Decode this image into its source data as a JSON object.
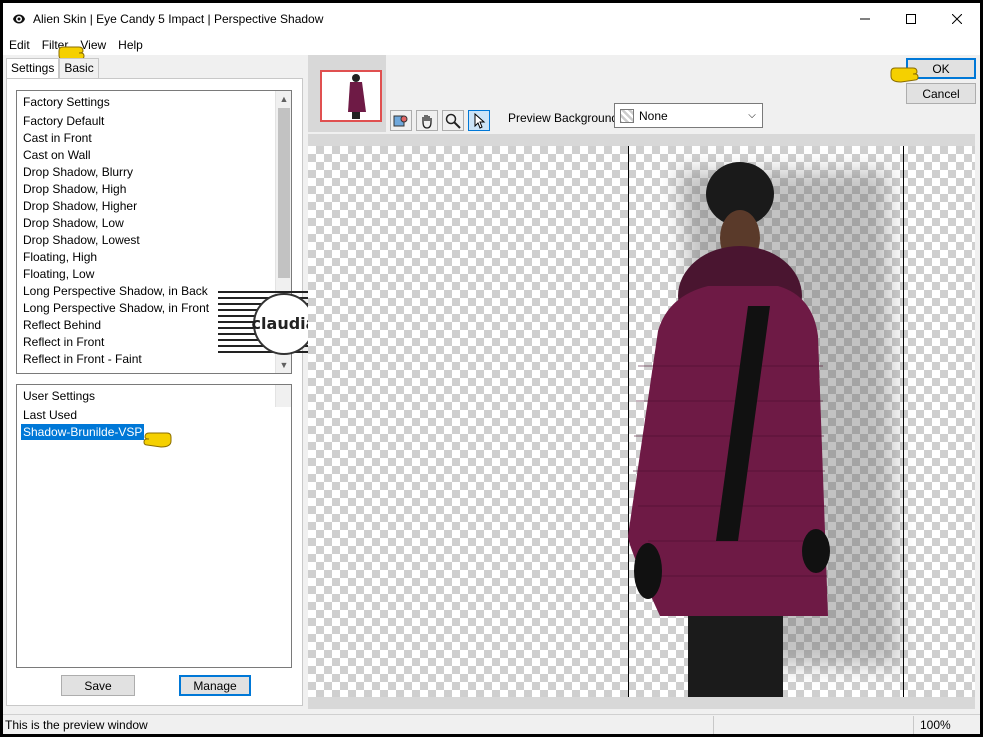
{
  "window": {
    "title": "Alien Skin | Eye Candy 5 Impact | Perspective Shadow"
  },
  "menu": [
    "Edit",
    "Filter",
    "View",
    "Help"
  ],
  "tabs": {
    "settings": "Settings",
    "basic": "Basic"
  },
  "factory": {
    "header": "Factory Settings",
    "items": [
      "Factory Default",
      "Cast in Front",
      "Cast on Wall",
      "Drop Shadow, Blurry",
      "Drop Shadow, High",
      "Drop Shadow, Higher",
      "Drop Shadow, Low",
      "Drop Shadow, Lowest",
      "Floating, High",
      "Floating, Low",
      "Long Perspective Shadow, in Back",
      "Long Perspective Shadow, in Front",
      "Reflect Behind",
      "Reflect in Front",
      "Reflect in Front - Faint"
    ]
  },
  "user": {
    "header": "User Settings",
    "items": [
      "Last Used",
      "Shadow-Brunilde-VSP"
    ],
    "selected": "Shadow-Brunilde-VSP"
  },
  "buttons": {
    "save": "Save",
    "manage": "Manage",
    "ok": "OK",
    "cancel": "Cancel"
  },
  "preview": {
    "background_label": "Preview Background:",
    "background_value": "None"
  },
  "watermark": {
    "text": "claudia"
  },
  "status": {
    "message": "This is the preview window",
    "zoom": "100%"
  },
  "colors": {
    "selection": "#0078d7",
    "thumb_border": "#e05050",
    "coat": "#6e1a45"
  },
  "icons": [
    "app-eye-icon",
    "minimize-icon",
    "maximize-icon",
    "close-icon",
    "navigator-icon",
    "hand-icon",
    "zoom-icon",
    "pointer-icon",
    "pointing-hand-icon"
  ]
}
